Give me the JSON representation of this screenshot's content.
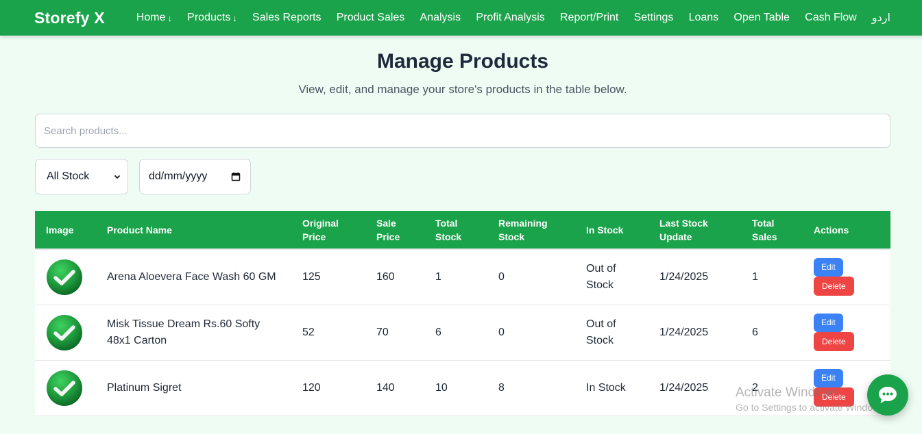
{
  "navbar": {
    "brand": "Storefy X",
    "links": [
      {
        "label": "Home",
        "dropdown": true
      },
      {
        "label": "Products",
        "dropdown": true
      },
      {
        "label": "Sales Reports",
        "dropdown": false
      },
      {
        "label": "Product Sales",
        "dropdown": false
      },
      {
        "label": "Analysis",
        "dropdown": false
      },
      {
        "label": "Profit Analysis",
        "dropdown": false
      },
      {
        "label": "Report/Print",
        "dropdown": false
      },
      {
        "label": "Settings",
        "dropdown": false
      },
      {
        "label": "Loans",
        "dropdown": false
      },
      {
        "label": "Open Table",
        "dropdown": false
      },
      {
        "label": "Cash Flow",
        "dropdown": false
      },
      {
        "label": "اردو",
        "dropdown": false
      }
    ],
    "dropdown_arrow": "↓"
  },
  "page": {
    "title": "Manage Products",
    "subtitle": "View, edit, and manage your store's products in the table below."
  },
  "search": {
    "placeholder": "Search products...",
    "value": ""
  },
  "filters": {
    "stock_select": {
      "selected": "All Stock"
    },
    "date_input": {
      "placeholder": "dd/mm/yyyy"
    }
  },
  "table": {
    "headers": {
      "image": "Image",
      "name": "Product Name",
      "original_price": [
        "Original",
        "Price"
      ],
      "sale_price": [
        "Sale",
        "Price"
      ],
      "total_stock": [
        "Total",
        "Stock"
      ],
      "remaining_stock": [
        "Remaining",
        "Stock"
      ],
      "in_stock": "In Stock",
      "last_update": [
        "Last Stock",
        "Update"
      ],
      "total_sales": [
        "Total",
        "Sales"
      ],
      "actions": "Actions"
    },
    "rows": [
      {
        "image": "green-check",
        "name": "Arena Aloevera Face Wash 60 GM",
        "original_price": "125",
        "sale_price": "160",
        "total_stock": "1",
        "remaining_stock": "0",
        "in_stock": "Out of Stock",
        "last_update": "1/24/2025",
        "total_sales": "1"
      },
      {
        "image": "green-check",
        "name": "Misk Tissue Dream Rs.60 Softy 48x1 Carton",
        "original_price": "52",
        "sale_price": "70",
        "total_stock": "6",
        "remaining_stock": "0",
        "in_stock": "Out of Stock",
        "last_update": "1/24/2025",
        "total_sales": "6"
      },
      {
        "image": "green-check",
        "name": "Platinum Sigret",
        "original_price": "120",
        "sale_price": "140",
        "total_stock": "10",
        "remaining_stock": "8",
        "in_stock": "In Stock",
        "last_update": "1/24/2025",
        "total_sales": "2"
      }
    ],
    "edit_label": "Edit",
    "delete_label": "Delete"
  },
  "watermark": {
    "line1": "Activate Windows",
    "line2": "Go to Settings to activate Windows."
  },
  "chat_button": {
    "icon": "chat-bubble-icon"
  },
  "colors": {
    "brand_green": "#1aa34a",
    "background": "#effcf3",
    "edit_blue": "#3b82f6",
    "delete_red": "#ef4444"
  }
}
